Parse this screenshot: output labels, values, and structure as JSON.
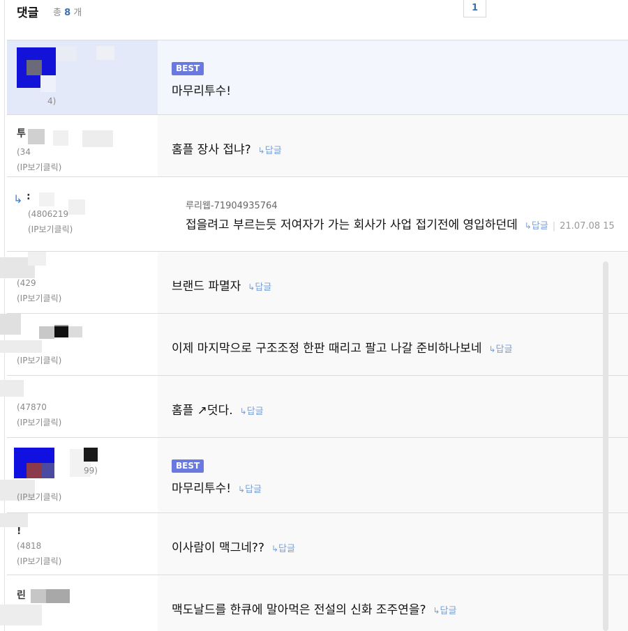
{
  "header": {
    "title": "댓글",
    "total_prefix": "총",
    "total_count": "8",
    "total_suffix": "개",
    "page": "1"
  },
  "reply_link_label": "답글",
  "comments": [
    {
      "kind": "best",
      "badge": "BEST",
      "number": "4)",
      "ip": "",
      "text": "마무리투수!",
      "reply": false
    },
    {
      "kind": "normal",
      "user": "투",
      "number": "(34",
      "ip": "(IP보기클릭)",
      "text": "홈플 장사 접냐?",
      "reply": true
    },
    {
      "kind": "reply",
      "user": ":",
      "number": "(4806219",
      "ip": "(IP보기클릭)",
      "writer": "루리웹-71904935764",
      "text": "접을려고 부르는듯 저여자가 가는 회사가 사업 접기전에 영입하던데",
      "date": "21.07.08 15",
      "reply": true
    },
    {
      "kind": "normal",
      "user": "",
      "number": "(429",
      "ip": "(IP보기클릭)",
      "text": "브랜드 파멸자",
      "reply": true
    },
    {
      "kind": "normal",
      "user": "",
      "number": "",
      "ip": "(IP보기클릭)",
      "text": "이제 마지막으로 구조조정 한판 때리고 팔고 나갈 준비하나보네",
      "reply": true
    },
    {
      "kind": "normal",
      "user": "",
      "number": "(47870",
      "ip": "(IP보기클릭)",
      "text": "홈플 ↗덧다.",
      "reply": true
    },
    {
      "kind": "best",
      "badge": "BEST",
      "user": "",
      "number": "99)",
      "ip": "(IP보기클릭)",
      "text": "마무리투수!",
      "reply": true
    },
    {
      "kind": "normal",
      "user": "!",
      "number": "(4818",
      "ip": "(IP보기클릭)",
      "text": "이사람이 맥그네??",
      "reply": true
    },
    {
      "kind": "normal",
      "user": "린",
      "number": "",
      "ip": "",
      "text": "맥도날드를 한큐에 말아먹은 전설의 신화 조주연을?",
      "reply": true
    }
  ],
  "colors": {
    "accent": "#3b6fb6",
    "badge": "#6a79e0",
    "reply_link": "#7aa0d6",
    "best_bg": "#e3e9f9"
  },
  "icons": {
    "reply_link": "reply-arrow-icon",
    "reply_marker": "reply-indent-icon"
  }
}
